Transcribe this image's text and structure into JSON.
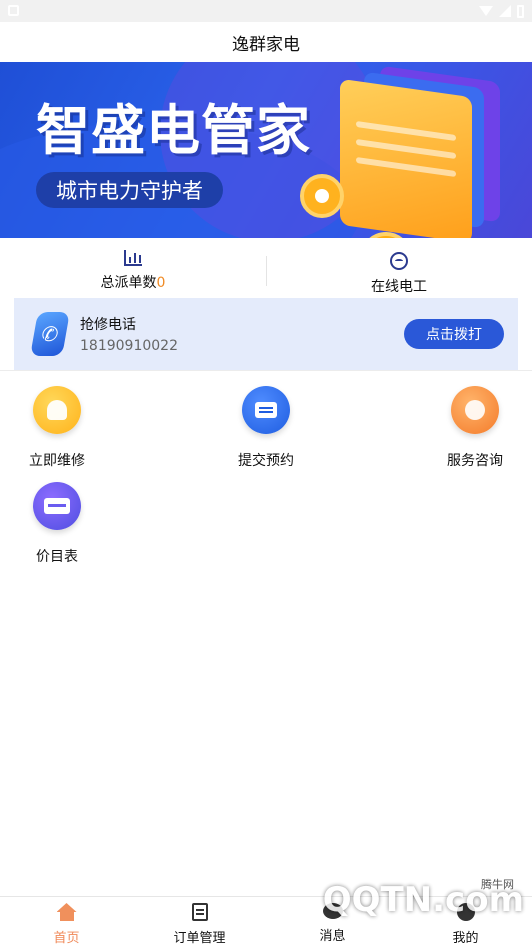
{
  "app": {
    "title": "逸群家电"
  },
  "banner": {
    "headline": "智盛电管家",
    "subline": "城市电力守护者"
  },
  "stats": {
    "dispatch_label": "总派单数",
    "dispatch_count": "0",
    "online_label": "在线电工"
  },
  "hotline": {
    "title": "抢修电话",
    "number": "18190910022",
    "call_label": "点击拨打"
  },
  "grid": [
    {
      "label": "立即维修",
      "icon": "repair-icon"
    },
    {
      "label": "提交预约",
      "icon": "chat-icon"
    },
    {
      "label": "服务咨询",
      "icon": "consult-icon"
    },
    {
      "label": "价目表",
      "icon": "price-list-icon"
    }
  ],
  "tabs": [
    {
      "label": "首页",
      "icon": "home-icon",
      "active": true
    },
    {
      "label": "订单管理",
      "icon": "clipboard-icon",
      "active": false
    },
    {
      "label": "消息",
      "icon": "message-icon",
      "active": false
    },
    {
      "label": "我的",
      "icon": "profile-icon",
      "active": false
    }
  ],
  "watermark": {
    "text": "QQTN.com",
    "small": "腾牛网"
  },
  "colors": {
    "accent": "#2a58d8",
    "tab_active": "#f08a5a",
    "count": "#f08a24"
  }
}
